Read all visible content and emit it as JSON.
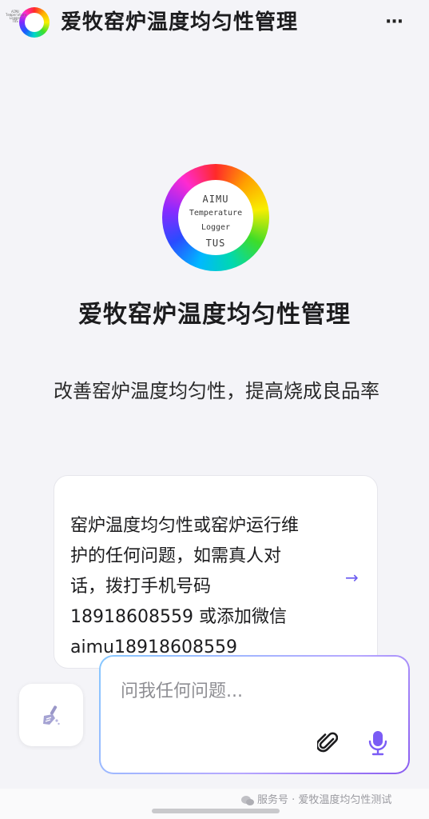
{
  "header": {
    "logo_text": [
      "AIMU",
      "Temperature",
      "Logger",
      "TUS"
    ],
    "title": "爱牧窑炉温度均匀性管理",
    "menu_icon": "more-horizontal-icon"
  },
  "bot": {
    "logo_lines": {
      "line1": "AIMU",
      "line2": "Temperature",
      "line3": "Logger",
      "line4": "TUS"
    },
    "name": "爱牧窑炉温度均匀性管理",
    "description": "改善窑炉温度均匀性，提高烧成良品率"
  },
  "suggestion_card": {
    "text": "窑炉温度均匀性或窑炉运行维护的任何问题，如需真人对话，拨打手机号码18918608559 或添加微信 aimu18918608559",
    "arrow_icon": "arrow-right-icon"
  },
  "composer": {
    "placeholder": "问我任何问题...",
    "clear_icon": "broom-icon",
    "attach_icon": "paperclip-icon",
    "mic_icon": "microphone-icon"
  },
  "watermark": {
    "icon": "wechat-icon",
    "text": "服务号 · 爱牧温度均匀性测试"
  },
  "colors": {
    "accent": "#6b5cf0",
    "mic": "#7b5cf5",
    "background": "#f4f4f8"
  }
}
